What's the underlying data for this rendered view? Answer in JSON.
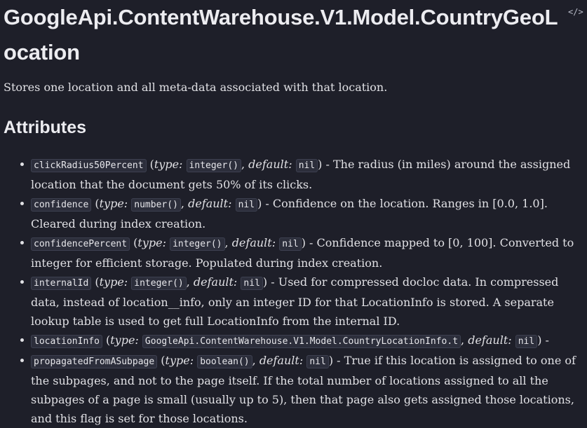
{
  "header": {
    "title": "GoogleApi.ContentWarehouse.V1.Model.CountryGeoLocation",
    "source_link": "</>"
  },
  "summary": "Stores one location and all meta-data associated with that location.",
  "attributes_heading": "Attributes",
  "labels": {
    "type": "type:",
    "default": "default:"
  },
  "attributes": [
    {
      "name": "clickRadius50Percent",
      "type": "integer()",
      "default": "nil",
      "description": " - The radius (in miles) around the assigned location that the document gets 50% of its clicks."
    },
    {
      "name": "confidence",
      "type": "number()",
      "default": "nil",
      "description": " - Confidence on the location. Ranges in [0.0, 1.0]. Cleared during index creation."
    },
    {
      "name": "confidencePercent",
      "type": "integer()",
      "default": "nil",
      "description": " - Confidence mapped to [0, 100]. Converted to integer for efficient storage. Populated during index creation."
    },
    {
      "name": "internalId",
      "type": "integer()",
      "default": "nil",
      "description": " - Used for compressed docloc data. In compressed data, instead of location__info, only an integer ID for that LocationInfo is stored. A separate lookup table is used to get full LocationInfo from the internal ID."
    },
    {
      "name": "locationInfo",
      "type": "GoogleApi.ContentWarehouse.V1.Model.CountryLocationInfo.t",
      "default": "nil",
      "description": " -"
    },
    {
      "name": "propagatedFromASubpage",
      "type": "boolean()",
      "default": "nil",
      "description": " - True if this location is assigned to one of the subpages, and not to the page itself. If the total number of locations assigned to all the subpages of a page is small (usually up to 5), then that page also gets assigned those locations, and this flag is set for those locations."
    }
  ]
}
